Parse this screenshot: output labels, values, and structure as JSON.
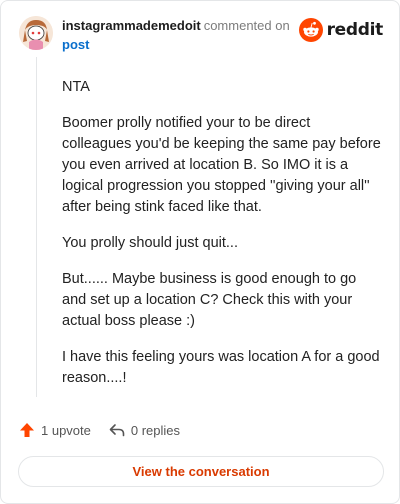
{
  "header": {
    "username": "instagrammademedoit",
    "action_text": "commented on",
    "post_link": "post"
  },
  "brand": {
    "wordmark": "reddit",
    "icon": "reddit-alien-icon",
    "accent_color": "#ff4500"
  },
  "avatar": {
    "icon": "snoo-avatar-icon"
  },
  "comment": {
    "paragraphs": [
      "NTA",
      "Boomer prolly notified your to be direct colleagues you'd be keeping the same pay before you even arrived at location B. So IMO it is a logical progression you stopped ''giving your all'' after being stink faced like that.",
      "You prolly should just quit...",
      "But...... Maybe business is good enough to go and set up a location C? Check this with your actual boss please :)",
      "I have this feeling yours was location A for a good reason....!"
    ]
  },
  "actions": {
    "upvote_label": "1 upvote",
    "upvote_icon": "upvote-arrow-icon",
    "reply_label": "0 replies",
    "reply_icon": "reply-arrow-icon"
  },
  "cta": {
    "label": "View the conversation",
    "color": "#d93a00"
  }
}
